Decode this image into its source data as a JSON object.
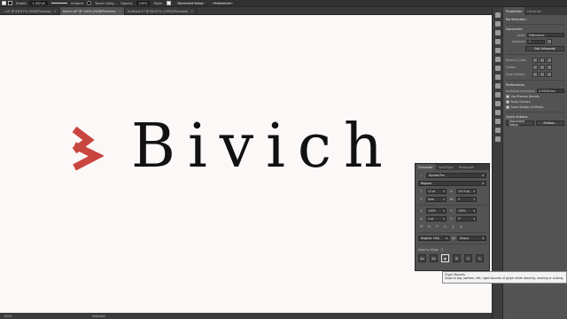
{
  "control_bar": {
    "stroke_label": "Stroke",
    "stroke_weight": "1.452 pt",
    "brush_label": "Uniform",
    "style_name": "Touch Callig...",
    "opacity_label": "Opacity",
    "opacity_value": "100%",
    "style_label": "Style:",
    "doc_setup_label": "Document Setup",
    "preferences_label": "Preferences"
  },
  "tabs": [
    {
      "label": "...ai* @ 66.67% (RGB/Preview)",
      "active": false
    },
    {
      "label": "bivich.ai* @ 100% (RGB/Preview)",
      "active": true
    },
    {
      "label": "Untitled-1* @ 66.67% (CMYK/Preview)",
      "active": false
    }
  ],
  "canvas": {
    "wordmark": "Bivich",
    "logo_color": "#c9453f"
  },
  "status_bar": {
    "zoom": "100%",
    "tool": "Selection"
  },
  "properties_panel": {
    "tabs": [
      "Properties",
      "Libraries"
    ],
    "no_selection": "No Selection",
    "document_heading": "Document",
    "units_label": "Units:",
    "units_value": "Millimeters",
    "artboard_label": "Artboard:",
    "artboard_value": "1",
    "edit_artboards": "Edit Artboards",
    "rulers_grids": "Rulers & Grids",
    "guides": "Guides",
    "snap_options": "Snap Options",
    "preferences_heading": "Preferences",
    "keyboard_increment_label": "Keyboard Increment:",
    "keyboard_increment_value": "0.3528 mm",
    "use_preview_bounds": "Use Preview Bounds",
    "scale_corners": "Scale Corners",
    "scale_strokes": "Scale Strokes & Effects",
    "quick_actions": "Quick Actions",
    "document_setup_btn": "Document Setup",
    "preferences_btn": "Prefere..."
  },
  "character_panel": {
    "tabs": [
      "Character",
      "OpenType",
      "Paragraph"
    ],
    "font_family": "Myriad Pro",
    "font_style": "Regular",
    "font_size": "12 pt",
    "leading": "(14.4 pt)",
    "kerning": "Auto",
    "tracking": "0",
    "vertical_scale": "100%",
    "horizontal_scale": "100%",
    "baseline_shift": "0 pt",
    "rotation": "0°",
    "language": "English: USA",
    "aa_label": "aa",
    "aa_value": "Sharp",
    "snap_to_glyph": "Snap to Glyph"
  },
  "tooltip": {
    "title": "Glyph Bounds",
    "body": "Snap to top, bottom, left, right bounds of glyph while drawing, moving or scaling."
  }
}
